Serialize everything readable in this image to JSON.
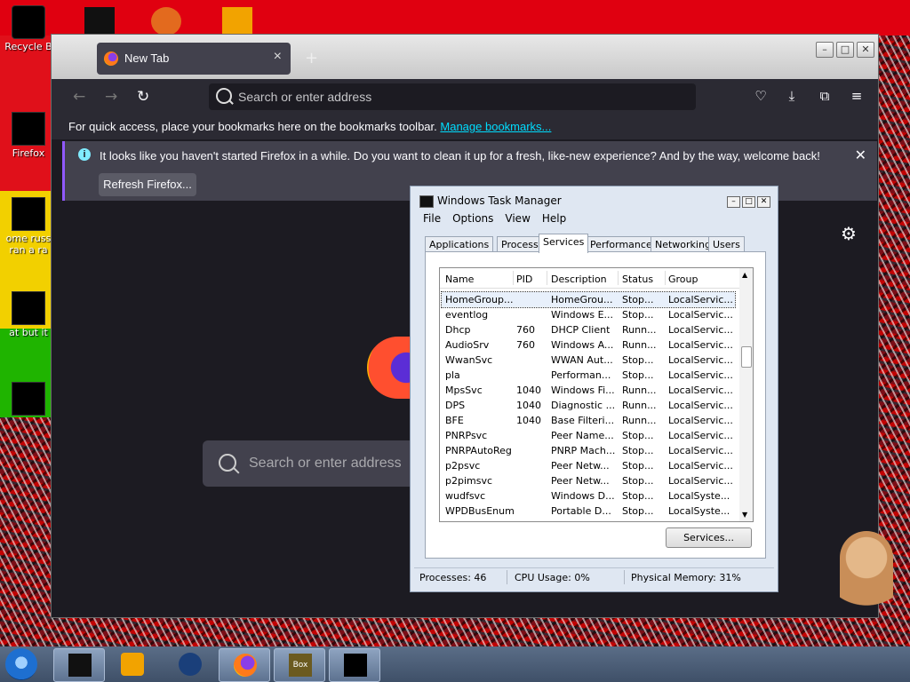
{
  "desktop": {
    "icons": [
      {
        "label": "Recycle Bin",
        "shown": "Recycle B"
      },
      {
        "label": "Firefox",
        "shown": "Firefox"
      },
      {
        "label": "some russ... ran a ra...",
        "shown": "ome russ"
      },
      {
        "label": "at but it",
        "shown": "at but it"
      }
    ],
    "icon_line2": "ran a ra"
  },
  "firefox": {
    "tab_title": "New Tab",
    "new_tab_symbol": "+",
    "url_placeholder": "Search or enter address",
    "bookmarks_text": "For quick access, place your bookmarks here on the bookmarks toolbar.",
    "bookmarks_link": "Manage bookmarks...",
    "notice_text": "It looks like you haven't started Firefox in a while. Do you want to clean it up for a fresh, like-new experience? And by the way, welcome back!",
    "refresh_button": "Refresh Firefox...",
    "search_placeholder": "Search or enter address",
    "accent": "#9059ff",
    "link_color": "#00ddff"
  },
  "taskmanager": {
    "title": "Windows Task Manager",
    "menu": [
      "File",
      "Options",
      "View",
      "Help"
    ],
    "tabs": [
      "Applications",
      "Processes",
      "Services",
      "Performance",
      "Networking",
      "Users"
    ],
    "active_tab": "Services",
    "columns": [
      "Name",
      "PID",
      "Description",
      "Status",
      "Group"
    ],
    "rows": [
      [
        "HomeGroup...",
        "",
        "HomeGrou...",
        "Stop...",
        "LocalServic..."
      ],
      [
        "eventlog",
        "",
        "Windows E...",
        "Stop...",
        "LocalServic..."
      ],
      [
        "Dhcp",
        "760",
        "DHCP Client",
        "Runn...",
        "LocalServic..."
      ],
      [
        "AudioSrv",
        "760",
        "Windows A...",
        "Runn...",
        "LocalServic..."
      ],
      [
        "WwanSvc",
        "",
        "WWAN Aut...",
        "Stop...",
        "LocalServic..."
      ],
      [
        "pla",
        "",
        "Performan...",
        "Stop...",
        "LocalServic..."
      ],
      [
        "MpsSvc",
        "1040",
        "Windows Fi...",
        "Runn...",
        "LocalServic..."
      ],
      [
        "DPS",
        "1040",
        "Diagnostic ...",
        "Runn...",
        "LocalServic..."
      ],
      [
        "BFE",
        "1040",
        "Base Filteri...",
        "Runn...",
        "LocalServic..."
      ],
      [
        "PNRPsvc",
        "",
        "Peer Name...",
        "Stop...",
        "LocalServic..."
      ],
      [
        "PNRPAutoReg",
        "",
        "PNRP Mach...",
        "Stop...",
        "LocalServic..."
      ],
      [
        "p2psvc",
        "",
        "Peer Netw...",
        "Stop...",
        "LocalServic..."
      ],
      [
        "p2pimsvc",
        "",
        "Peer Netw...",
        "Stop...",
        "LocalServic..."
      ],
      [
        "wudfsvc",
        "",
        "Windows D...",
        "Stop...",
        "LocalSyste..."
      ],
      [
        "WPDBusEnum",
        "",
        "Portable D...",
        "Stop...",
        "LocalSyste..."
      ]
    ],
    "services_button": "Services...",
    "status": {
      "processes": "Processes: 46",
      "cpu": "CPU Usage: 0%",
      "memory": "Physical Memory: 31%"
    }
  },
  "taskbar": {
    "apps": [
      "start-orb",
      "task-manager",
      "media-player",
      "globe",
      "firefox",
      "hamster-box",
      "terminal"
    ],
    "box_label": "Box"
  }
}
